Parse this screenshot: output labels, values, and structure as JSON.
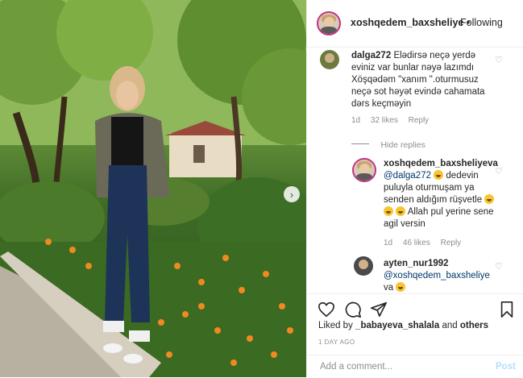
{
  "post": {
    "username": "xoshqedem_baxsheliye",
    "separator": "•",
    "follow_status": "Following",
    "likes_prefix": "Liked by",
    "liked_by_user": "_babayeva_shalala",
    "likes_and": "and",
    "likes_others": "others",
    "time_ago": "1 DAY AGO",
    "add_comment_placeholder": "Add a comment...",
    "post_label": "Post"
  },
  "comments": [
    {
      "username": "dalga272",
      "text": "Elədirsə neçə yerdə eviniz var bunlar nəyə lazımdı Xöşqədəm \"xanım \".oturmusuz neçə sot həyət evində cahamata dərs keçməyin",
      "time": "1d",
      "likes": "32 likes",
      "reply": "Reply"
    },
    {
      "hide_replies": "Hide replies"
    },
    {
      "username": "xoshqedem_baxsheliyeva",
      "mention": "@dalga272",
      "text_part1": "dedevin puluyla oturmuşam ya senden aldığım rüşvetle",
      "text_part2": "Allah pul yerine sene agil versin",
      "time": "1d",
      "likes": "46 likes",
      "reply": "Reply"
    },
    {
      "username": "ayten_nur1992",
      "mention": "@xoshqedem_baxsheliye",
      "text": "va"
    }
  ],
  "icons": {
    "heart": "heart-icon",
    "comment": "comment-icon",
    "share": "share-icon",
    "save": "bookmark-icon",
    "next": "chevron-right-icon"
  },
  "colors": {
    "accent_ring": "#c13584",
    "link": "#00376b",
    "muted": "#8e8e8e",
    "post_disabled": "#b2dffc"
  }
}
